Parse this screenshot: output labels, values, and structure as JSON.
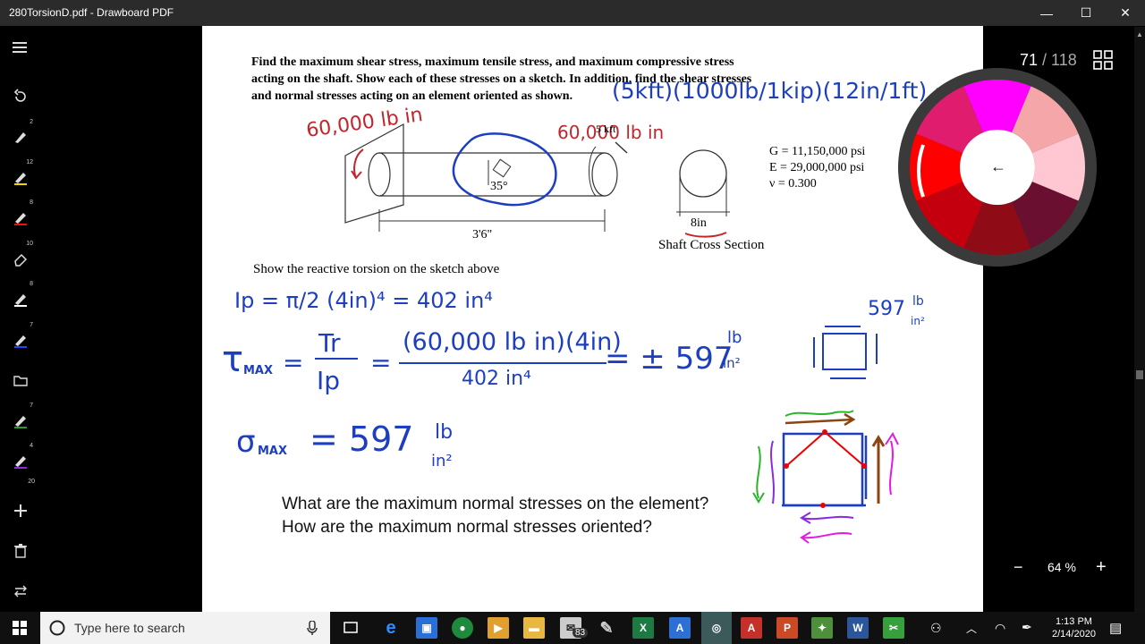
{
  "window": {
    "title": "280TorsionD.pdf - Drawboard PDF",
    "controls": {
      "minimize": "—",
      "maximize": "☐",
      "close": "✕"
    }
  },
  "toolbar": {
    "badges": [
      "2",
      "12",
      "8",
      "10",
      "8",
      "7",
      "7",
      "4",
      "20"
    ]
  },
  "document": {
    "problem_text": [
      "Find the maximum shear stress, maximum tensile stress, and maximum compressive stress",
      "acting on the shaft.  Show each of these stresses on a sketch.  In addition, find the shear stresses",
      "and normal stresses acting on an element oriented as shown."
    ],
    "properties": [
      "G = 11,150,000 psi",
      "E = 29,000,000 psi",
      "ν = 0.300"
    ],
    "labels": {
      "torque": "5 kft",
      "angle": "35°",
      "length": "3'6\"",
      "diameter": "8in",
      "cross_section": "Shaft Cross Section",
      "reactive": "Show the reactive torsion on the sketch above"
    },
    "questions": [
      "What are the maximum normal stresses on the element?",
      "How are the maximum normal stresses oriented?"
    ],
    "handwriting": {
      "conversion": "(5kft)(1000lb/1kip)(12in/1ft) = 60,000 lb",
      "torque_red_left": "60,000 lb in",
      "torque_red_right": "60,000 lb in",
      "ip": "Ip = π/2 (4in)⁴ = 402 in⁴",
      "tau_label": "τ",
      "tau_sub": "MAX",
      "tau_frac_num": "Tr",
      "tau_frac_den": "Ip",
      "tau_num": "(60,000 lb in)(4in)",
      "tau_den": "402 in⁴",
      "tau_result": "= ± 597",
      "unit_num": "lb",
      "unit_den": "in²",
      "sigma_label": "σ",
      "sigma_sub": "MAX",
      "sigma_value": "= 597",
      "element_value": "597"
    }
  },
  "viewer": {
    "page_current": "71",
    "page_total": "118",
    "zoom": "64 %",
    "zoom_out": "−",
    "zoom_in": "+",
    "back_arrow": "←"
  },
  "colors": {
    "wheel": [
      "#ff00ff",
      "#f4a6a9",
      "#ffc7d1",
      "#6a0f30",
      "#8f0b16",
      "#c4000e",
      "#ff0000",
      "#e01c6e"
    ],
    "ink_blue": "#1d3fbf",
    "ink_red": "#c0262c"
  },
  "taskbar": {
    "search_placeholder": "Type here to search",
    "time": "1:13 PM",
    "date": "2/14/2020",
    "mail_badge": "83"
  }
}
